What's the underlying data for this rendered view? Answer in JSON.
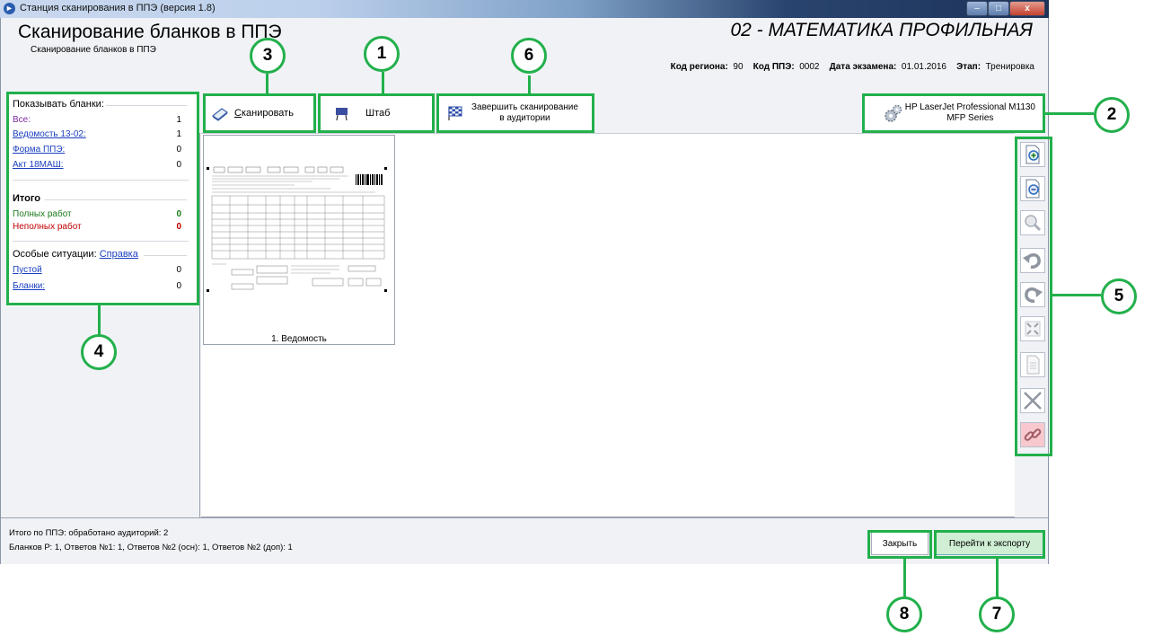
{
  "window": {
    "title": "Станция сканирования в ППЭ (версия 1.8)",
    "controls": {
      "minimize": "–",
      "maximize": "□",
      "close": "x"
    }
  },
  "header": {
    "heading": "Сканирование бланков в ППЭ",
    "subheading": "Сканирование бланков в ППЭ",
    "subject": "02 - МАТЕМАТИКА ПРОФИЛЬНАЯ",
    "region_label": "Код региона:",
    "region_value": "90",
    "ppe_label": "Код ППЭ:",
    "ppe_value": "0002",
    "date_label": "Дата экзамена:",
    "date_value": "01.01.2016",
    "stage_label": "Этап:",
    "stage_value": "Тренировка"
  },
  "toolbar": {
    "scan_label": "Сканировать",
    "scan_underline": "С",
    "scan_rest": "канировать",
    "staff_label": "Штаб",
    "finish_label_line1": "Завершить сканирование",
    "finish_label_line2": "в аудитории",
    "printer_line1": "HP LaserJet Professional M1130",
    "printer_line2": "MFP Series"
  },
  "left_panel": {
    "show_title": "Показывать бланки:",
    "rows": [
      {
        "label": "Все:",
        "value": "1"
      },
      {
        "label": "Ведомость 13-02:",
        "value": "1"
      },
      {
        "label": "Форма ППЭ:",
        "value": "0"
      },
      {
        "label": "Акт 18МАШ:",
        "value": "0"
      }
    ],
    "totals_title": "Итого",
    "full_label": "Полных работ",
    "full_value": "0",
    "partial_label": "Неполных работ",
    "partial_value": "0",
    "special_label": "Особые ситуации:",
    "help_link": "Справка",
    "special_rows": [
      {
        "label": "Пустой",
        "value": "0"
      },
      {
        "label": "Бланки:",
        "value": "0"
      }
    ]
  },
  "thumbnail": {
    "label": "1. Ведомость"
  },
  "side_tools": [
    "zoom-in-icon",
    "zoom-out-icon",
    "zoom-fit-icon",
    "rotate-left-icon",
    "rotate-right-icon",
    "fit-page-icon",
    "page-icon",
    "delete-icon",
    "link-icon"
  ],
  "status": {
    "line1": "Итого по ППЭ: обработано аудиторий: 2",
    "line2": "Бланков Р: 1, Ответов №1: 1, Ответов №2 (осн): 1, Ответов №2 (доп): 1"
  },
  "buttons": {
    "close_label": "Закрыть",
    "export_label": "Перейти к экспорту"
  },
  "annotations": [
    "1",
    "2",
    "3",
    "4",
    "5",
    "6",
    "7",
    "8"
  ],
  "colors": {
    "annotation_green": "#22b04b",
    "totals_green": "#1a7a1a",
    "totals_red": "#c00000",
    "link_blue": "#1a3fbf",
    "export_button": "#cfeed3"
  }
}
